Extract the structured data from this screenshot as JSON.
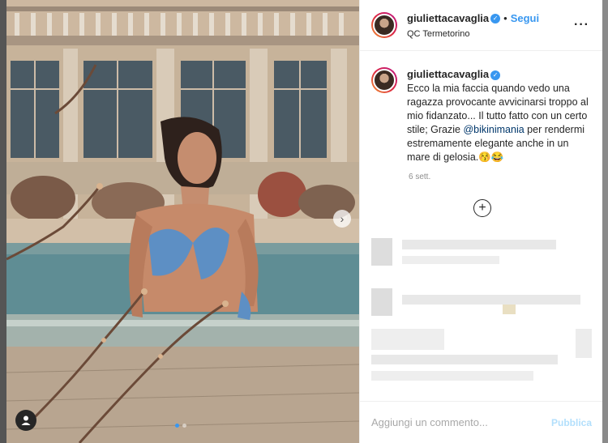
{
  "header": {
    "username": "giuliettacavaglia",
    "separator": "•",
    "follow_label": "Segui",
    "location": "QC Termetorino",
    "more_icon": "more-horizontal-icon"
  },
  "caption": {
    "username": "giuliettacavaglia",
    "text_before": "Ecco la mia faccia quando vedo una ragazza provocante avvicinarsi troppo al mio fidanzato... Il tutto fatto con un certo stile; Grazie ",
    "mention": "@bikinimania",
    "text_after": " per rendermi estremamente elegante anche in un mare di gelosia.😚😂",
    "timestamp": "6 sett."
  },
  "actions": {
    "load_more_icon": "plus-circle-icon"
  },
  "comment_box": {
    "placeholder": "Aggiungi un commento...",
    "publish_label": "Pubblica"
  },
  "carousel": {
    "next_icon": "chevron-right-icon",
    "user_tag_icon": "user-icon",
    "slide_count": 2,
    "active_slide": 1
  },
  "colors": {
    "accent": "#3897f0",
    "publish_disabled": "#b2dffc",
    "text": "#262626",
    "muted": "#8e8e8e"
  }
}
